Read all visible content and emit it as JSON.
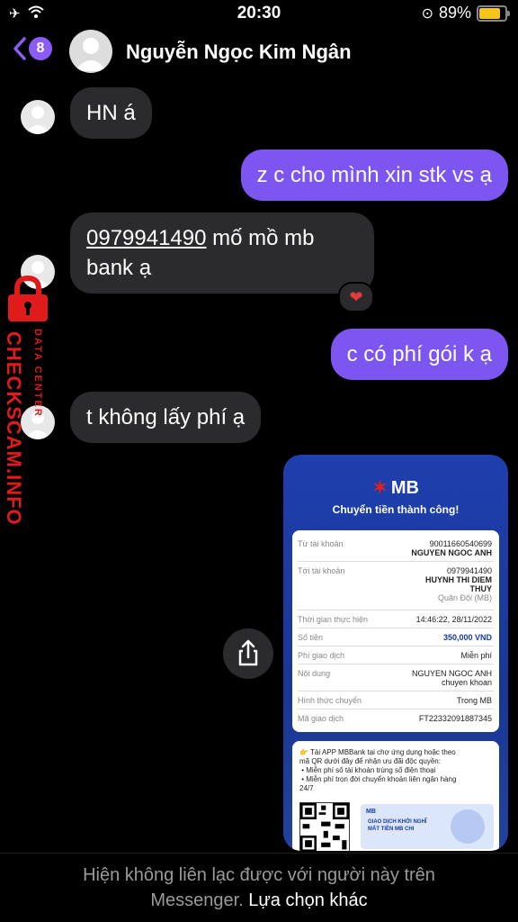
{
  "status_bar": {
    "time": "20:30",
    "battery_percent": "89%",
    "battery_level": 0.89
  },
  "header": {
    "back_badge": "8",
    "contact_name": "Nguyễn Ngọc Kim Ngân"
  },
  "messages": [
    {
      "direction": "incoming",
      "text": "HN á"
    },
    {
      "direction": "outgoing",
      "text": "z c cho mình xin stk vs ạ"
    },
    {
      "direction": "incoming",
      "phone": "0979941490",
      "line1_rest": " mố mồ mb",
      "line2": "bank ạ",
      "reaction": "❤"
    },
    {
      "direction": "outgoing",
      "text": "c có phí gói k ạ"
    },
    {
      "direction": "incoming",
      "text": "t không lấy phí ạ"
    }
  ],
  "watermark": {
    "text": "CHECKSCAM.INFO",
    "sub": "DATA CENTER"
  },
  "receipt": {
    "brand": "MB",
    "title": "Chuyển tiền thành công!",
    "rows": [
      {
        "label": "Từ tài khoản",
        "value": "90011660540699",
        "value2": "NGUYEN NGOC ANH"
      },
      {
        "label": "Tới tài khoản",
        "value": "0979941490",
        "value2": "HUYNH THI DIEM",
        "value3": "THUY",
        "value4": "Quân Đội (MB)"
      },
      {
        "label": "Thời gian thực hiện",
        "value": "14:46:22, 28/11/2022"
      },
      {
        "label": "Số tiền",
        "value": "350,000 VND"
      },
      {
        "label": "Phí giao dịch",
        "value": "Miễn phí"
      },
      {
        "label": "Nội dung",
        "value": "NGUYEN NGOC ANH",
        "value2": "chuyen khoan"
      },
      {
        "label": "Hình thức chuyển",
        "value": "Trong MB"
      },
      {
        "label": "Mã giao dịch",
        "value": "FT22332091887345"
      }
    ],
    "promo": {
      "line1": "Tải APP MBBank tại chợ ứng dụng hoặc theo",
      "line2": "mã QR dưới đây để nhận ưu đãi độc quyền:",
      "bullet1": "• Miễn phí số tài khoản trùng số điện thoại",
      "bullet2": "• Miễn phí trọn đời chuyển khoản liên ngân hàng",
      "line5": "24/7",
      "banner_brand": "MB",
      "banner_line1": "GIAO DỊCH KHỞI NGHĨ",
      "banner_line2": "MẤT TIỀN MB CHI"
    }
  },
  "footer": {
    "line1": "Hiện không liên lạc được với người này trên",
    "line2_prefix": "Messenger.",
    "link": "Lựa chọn khác"
  },
  "colors": {
    "accent": "#7d55f0",
    "incoming_bubble": "#2b2b2d",
    "mb_blue": "#1e3fae",
    "watermark_red": "#e01b1b"
  }
}
